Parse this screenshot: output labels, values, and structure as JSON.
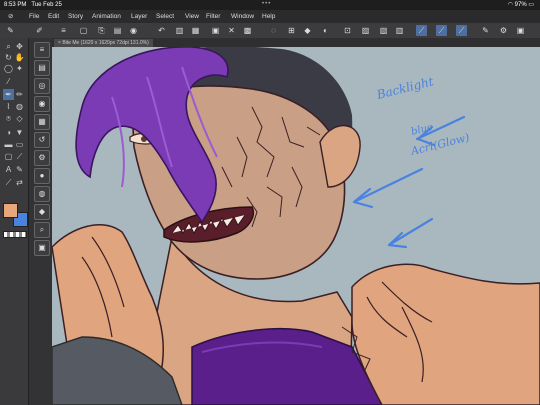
{
  "status_bar": {
    "time": "8:53 PM",
    "date": "Tue Feb 25",
    "dots": "•••",
    "battery": "97%"
  },
  "menu": [
    "File",
    "Edit",
    "Story",
    "Animation",
    "Layer",
    "Select",
    "View",
    "Filter",
    "Window",
    "Help"
  ],
  "document_tab": "Bite Me (1620 x 1620px 72dpi 131.0%)",
  "colors": {
    "main": "#e8a77a",
    "sub": "#4a82e0",
    "app_bg": "#3a3a3c",
    "canvas_bg": "#a9b8be"
  },
  "annotation_text": {
    "line1": "Backlight",
    "line2": "blue",
    "line3": "Acrl(Glow)"
  }
}
